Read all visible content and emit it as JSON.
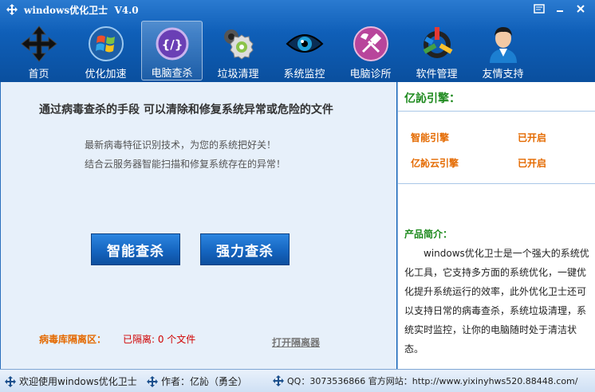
{
  "app": {
    "title": "windows优化卫士",
    "version": "V4.0"
  },
  "window_controls": [
    "menu",
    "minimize",
    "close"
  ],
  "nav": [
    {
      "label": "首页",
      "icon": "home-arrows-icon"
    },
    {
      "label": "优化加速",
      "icon": "windows-logo-icon"
    },
    {
      "label": "电脑查杀",
      "icon": "shield-scan-icon",
      "active": true
    },
    {
      "label": "垃圾清理",
      "icon": "gear-icon"
    },
    {
      "label": "系统监控",
      "icon": "eye-icon"
    },
    {
      "label": "电脑诊所",
      "icon": "tools-icon"
    },
    {
      "label": "软件管理",
      "icon": "software-icon"
    },
    {
      "label": "友情支持",
      "icon": "person-icon"
    }
  ],
  "main": {
    "heading": "通过病毒查杀的手段  可以清除和修复系统异常或危险的文件",
    "desc_line1": "最新病毒特征识别技术，为您的系统把好关！",
    "desc_line2": "结合云服务器智能扫描和修复系统存在的异常！",
    "smart_scan_label": "智能查杀",
    "force_scan_label": "强力查杀",
    "quarantine_label": "病毒库隔离区：",
    "quarantine_count": "已隔离: 0 个文件",
    "open_quarantine_label": "打开隔离器"
  },
  "side": {
    "engine_title": "亿訫引擎：",
    "engines": [
      {
        "name": "智能引擎",
        "status": "已开启"
      },
      {
        "name": "亿訫云引擎",
        "status": "已开启"
      }
    ],
    "intro_title": "产品简介：",
    "intro_text": "windows优化卫士是一个强大的系统优化工具，它支持多方面的系统优化，一键优化提升系统运行的效率，此外优化卫士还可以支持日常的病毒查杀，系统垃圾清理，系统实时监控，让你的电脑随时处于清洁状态。"
  },
  "statusbar": {
    "welcome": "欢迎使用windows优化卫士",
    "author": "作者：亿訫（勇全）",
    "contact": "QQ：3073536866  官方网站：http://www.yixinyhws520.88448.com/"
  },
  "colors": {
    "header_blue": "#0f5fb8",
    "accent_orange": "#e46a00",
    "title_green": "#1e8a1e",
    "button_blue": "#1565c0"
  }
}
